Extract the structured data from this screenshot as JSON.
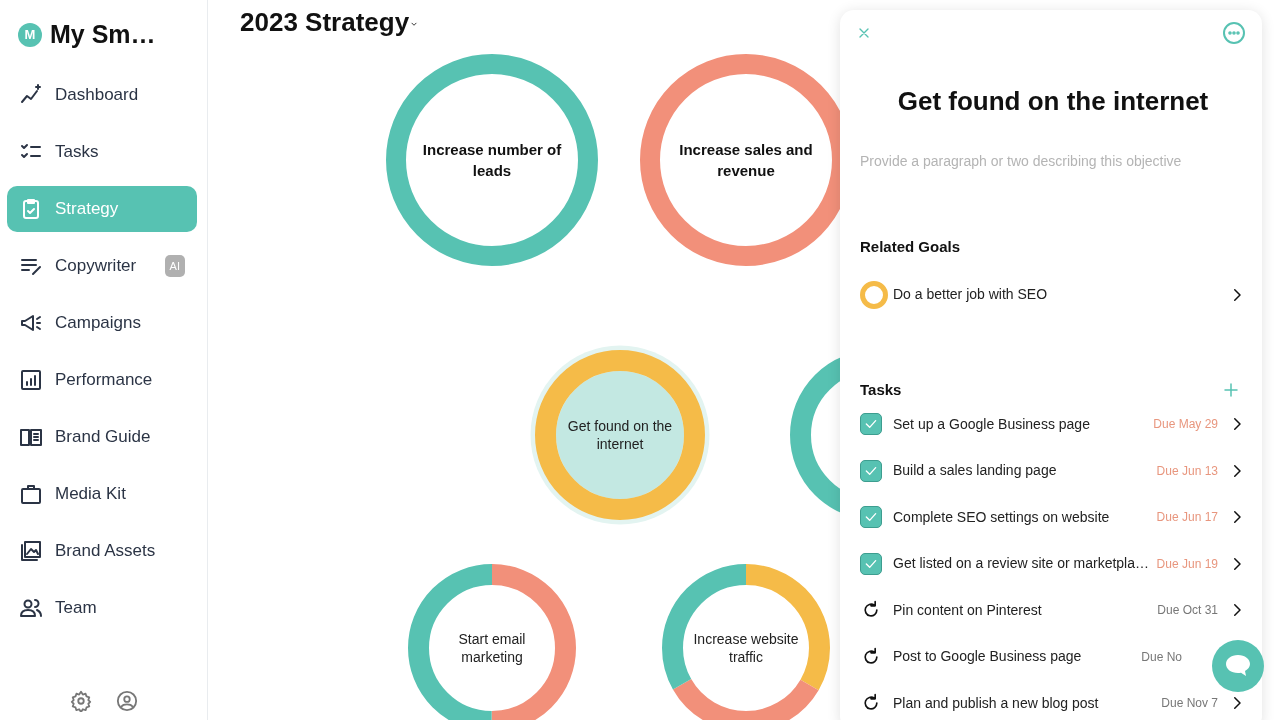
{
  "brand": {
    "avatar": "M",
    "name": "My Sm…"
  },
  "sidebar": {
    "items": [
      {
        "label": "Dashboard",
        "selected": false
      },
      {
        "label": "Tasks",
        "selected": false
      },
      {
        "label": "Strategy",
        "selected": true
      },
      {
        "label": "Copywriter",
        "selected": false,
        "badge": "AI"
      },
      {
        "label": "Campaigns",
        "selected": false
      },
      {
        "label": "Performance",
        "selected": false
      },
      {
        "label": "Brand Guide",
        "selected": false
      },
      {
        "label": "Media Kit",
        "selected": false
      },
      {
        "label": "Brand Assets",
        "selected": false
      },
      {
        "label": "Team",
        "selected": false
      }
    ]
  },
  "page_title": "2023 Strategy",
  "nodes": [
    {
      "kind": "goal",
      "label": "Increase number of leads",
      "selected": false,
      "segments": [
        {
          "color": "#57c2b2"
        }
      ]
    },
    {
      "kind": "goal",
      "label": "Increase sales and revenue",
      "selected": false,
      "segments": [
        {
          "color": "#f2907a"
        }
      ]
    },
    {
      "kind": "objective",
      "label": "Get found on the internet",
      "selected": true,
      "segments": [
        {
          "color": "#f5bb48"
        }
      ]
    },
    {
      "kind": "objective",
      "selected": false,
      "segments": [
        {
          "color": "#57c2b2"
        }
      ]
    },
    {
      "kind": "objective",
      "label": "Start email marketing",
      "selected": false,
      "segments": [
        {
          "color": "#f2907a"
        },
        {
          "color": "#57c2b2"
        }
      ]
    },
    {
      "kind": "objective",
      "label": "Increase website traffic",
      "selected": false,
      "segments": [
        {
          "color": "#f5bb48"
        },
        {
          "color": "#f2907a"
        },
        {
          "color": "#57c2b2"
        }
      ]
    }
  ],
  "panel": {
    "title": "Get found on the internet",
    "description": {
      "placeholder": "Provide a paragraph or two describing this objective"
    },
    "related_goals": {
      "heading": "Related Goals",
      "items": [
        {
          "label": "Do a better job with SEO",
          "color": "#f5bb48"
        }
      ]
    },
    "tasks": {
      "heading": "Tasks",
      "items": [
        {
          "kind": "checkbox",
          "checked": true,
          "label": "Set up a Google Business page",
          "due": "Due May 29",
          "color": "#e8967e"
        },
        {
          "kind": "checkbox",
          "checked": true,
          "label": "Build a sales landing page",
          "due": "Due Jun 13",
          "color": "#e8967e"
        },
        {
          "kind": "checkbox",
          "checked": true,
          "label": "Complete SEO settings on website",
          "due": "Due Jun 17",
          "color": "#e8967e"
        },
        {
          "kind": "checkbox",
          "checked": true,
          "label": "Get listed on a review site or marketpla…",
          "due": "Due Jun 19",
          "color": "#e8967e"
        },
        {
          "kind": "recurring",
          "label": "Pin content on Pinterest",
          "due": "Due Oct 31",
          "color": "#777777"
        },
        {
          "kind": "recurring",
          "label": "Post to Google Business page",
          "due": "Due No",
          "color": "#777777"
        },
        {
          "kind": "recurring",
          "label": "Plan and publish a new blog post",
          "due": "Due Nov 7",
          "color": "#777777"
        }
      ]
    }
  }
}
